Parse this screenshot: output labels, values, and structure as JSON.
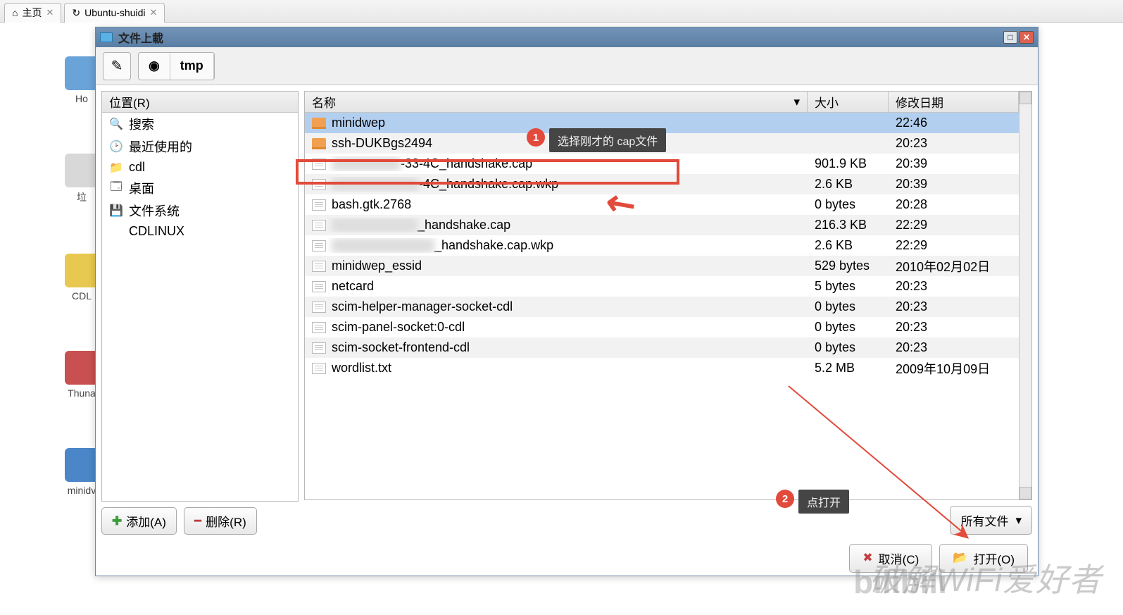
{
  "browser_tabs": [
    {
      "label": "主页",
      "icon": "home"
    },
    {
      "label": "Ubuntu-shuidi",
      "icon": "refresh"
    }
  ],
  "desktop": {
    "icons": [
      "Ho",
      "垃",
      "CDL",
      "Thuna",
      "minidv"
    ]
  },
  "dialog": {
    "title": "文件上載",
    "path": "tmp",
    "places_header": "位置(R)",
    "places": [
      {
        "label": "搜索",
        "icon": "🔍"
      },
      {
        "label": "最近使用的",
        "icon": "🕑"
      },
      {
        "label": "cdl",
        "icon": "📁"
      },
      {
        "label": "桌面",
        "icon": "🗔"
      },
      {
        "label": "文件系统",
        "icon": "💾"
      },
      {
        "label": "CDLINUX",
        "icon": ""
      }
    ],
    "add_btn": "添加(A)",
    "remove_btn": "删除(R)",
    "columns": {
      "name": "名称",
      "size": "大小",
      "date": "修改日期"
    },
    "filter_label": "所有文件",
    "cancel_btn": "取消(C)",
    "open_btn": "打开(O)",
    "files": [
      {
        "name": "minidwep",
        "type": "folder",
        "size": "",
        "date": "22:46",
        "selected": true
      },
      {
        "name": "ssh-DUKBgs2494",
        "type": "folder",
        "size": "",
        "date": "20:23"
      },
      {
        "name_prefix_blur": "xx-xx-xx-xx",
        "name_suffix": "-33-4C_handshake.cap",
        "type": "file",
        "size": "901.9 KB",
        "date": "20:39",
        "highlighted": true
      },
      {
        "name_prefix_blur": "xx-xx-xx-xx-33",
        "name_suffix": "-4C_handshake.cap.wkp",
        "type": "file",
        "size": "2.6 KB",
        "date": "20:39"
      },
      {
        "name": "bash.gtk.2768",
        "type": "file",
        "size": "0 bytes",
        "date": "20:28"
      },
      {
        "name_prefix_blur": "xx-xx-xx-xx-xx",
        "name_suffix": "_handshake.cap",
        "type": "file",
        "size": "216.3 KB",
        "date": "22:29"
      },
      {
        "name_prefix_blur": "xx-xx-xx-xx-xx-xx",
        "name_suffix": "_handshake.cap.wkp",
        "type": "file",
        "size": "2.6 KB",
        "date": "22:29"
      },
      {
        "name": "minidwep_essid",
        "type": "file",
        "size": "529 bytes",
        "date": "2010年02月02日"
      },
      {
        "name": "netcard",
        "type": "file",
        "size": "5 bytes",
        "date": "20:23"
      },
      {
        "name": "scim-helper-manager-socket-cdl",
        "type": "file",
        "size": "0 bytes",
        "date": "20:23"
      },
      {
        "name": "scim-panel-socket:0-cdl",
        "type": "file",
        "size": "0 bytes",
        "date": "20:23"
      },
      {
        "name": "scim-socket-frontend-cdl",
        "type": "file",
        "size": "0 bytes",
        "date": "20:23"
      },
      {
        "name": "wordlist.txt",
        "type": "file",
        "size": "5.2 MB",
        "date": "2009年10月09日"
      }
    ]
  },
  "annotations": {
    "callout1": "选择刚才的 cap文件",
    "callout2": "点打开",
    "badge1": "1",
    "badge2": "2"
  },
  "watermark": {
    "logo": "bilibili",
    "text": "破解WiFi爱好者"
  }
}
